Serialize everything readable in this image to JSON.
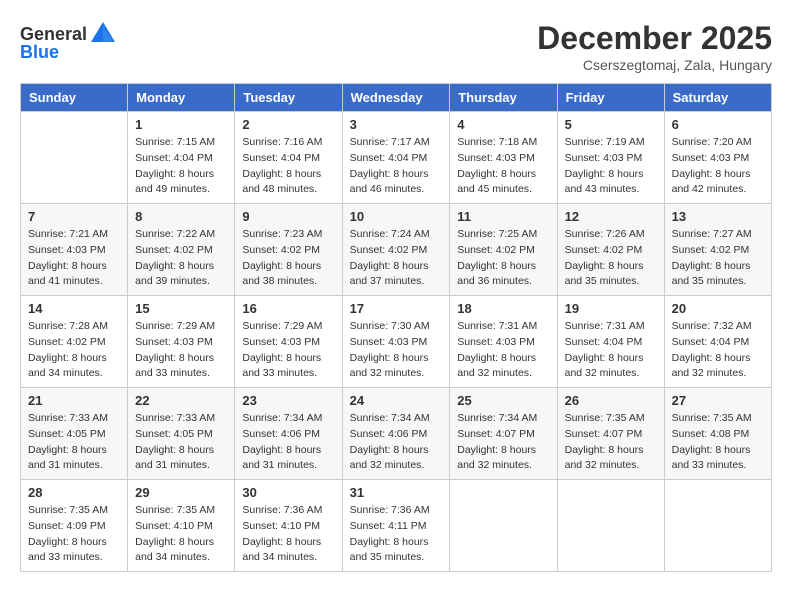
{
  "header": {
    "logo_general": "General",
    "logo_blue": "Blue",
    "month_title": "December 2025",
    "location": "Cserszegtomaj, Zala, Hungary"
  },
  "weekdays": [
    "Sunday",
    "Monday",
    "Tuesday",
    "Wednesday",
    "Thursday",
    "Friday",
    "Saturday"
  ],
  "weeks": [
    [
      {
        "day": "",
        "info": ""
      },
      {
        "day": "1",
        "info": "Sunrise: 7:15 AM\nSunset: 4:04 PM\nDaylight: 8 hours\nand 49 minutes."
      },
      {
        "day": "2",
        "info": "Sunrise: 7:16 AM\nSunset: 4:04 PM\nDaylight: 8 hours\nand 48 minutes."
      },
      {
        "day": "3",
        "info": "Sunrise: 7:17 AM\nSunset: 4:04 PM\nDaylight: 8 hours\nand 46 minutes."
      },
      {
        "day": "4",
        "info": "Sunrise: 7:18 AM\nSunset: 4:03 PM\nDaylight: 8 hours\nand 45 minutes."
      },
      {
        "day": "5",
        "info": "Sunrise: 7:19 AM\nSunset: 4:03 PM\nDaylight: 8 hours\nand 43 minutes."
      },
      {
        "day": "6",
        "info": "Sunrise: 7:20 AM\nSunset: 4:03 PM\nDaylight: 8 hours\nand 42 minutes."
      }
    ],
    [
      {
        "day": "7",
        "info": "Sunrise: 7:21 AM\nSunset: 4:03 PM\nDaylight: 8 hours\nand 41 minutes."
      },
      {
        "day": "8",
        "info": "Sunrise: 7:22 AM\nSunset: 4:02 PM\nDaylight: 8 hours\nand 39 minutes."
      },
      {
        "day": "9",
        "info": "Sunrise: 7:23 AM\nSunset: 4:02 PM\nDaylight: 8 hours\nand 38 minutes."
      },
      {
        "day": "10",
        "info": "Sunrise: 7:24 AM\nSunset: 4:02 PM\nDaylight: 8 hours\nand 37 minutes."
      },
      {
        "day": "11",
        "info": "Sunrise: 7:25 AM\nSunset: 4:02 PM\nDaylight: 8 hours\nand 36 minutes."
      },
      {
        "day": "12",
        "info": "Sunrise: 7:26 AM\nSunset: 4:02 PM\nDaylight: 8 hours\nand 35 minutes."
      },
      {
        "day": "13",
        "info": "Sunrise: 7:27 AM\nSunset: 4:02 PM\nDaylight: 8 hours\nand 35 minutes."
      }
    ],
    [
      {
        "day": "14",
        "info": "Sunrise: 7:28 AM\nSunset: 4:02 PM\nDaylight: 8 hours\nand 34 minutes."
      },
      {
        "day": "15",
        "info": "Sunrise: 7:29 AM\nSunset: 4:03 PM\nDaylight: 8 hours\nand 33 minutes."
      },
      {
        "day": "16",
        "info": "Sunrise: 7:29 AM\nSunset: 4:03 PM\nDaylight: 8 hours\nand 33 minutes."
      },
      {
        "day": "17",
        "info": "Sunrise: 7:30 AM\nSunset: 4:03 PM\nDaylight: 8 hours\nand 32 minutes."
      },
      {
        "day": "18",
        "info": "Sunrise: 7:31 AM\nSunset: 4:03 PM\nDaylight: 8 hours\nand 32 minutes."
      },
      {
        "day": "19",
        "info": "Sunrise: 7:31 AM\nSunset: 4:04 PM\nDaylight: 8 hours\nand 32 minutes."
      },
      {
        "day": "20",
        "info": "Sunrise: 7:32 AM\nSunset: 4:04 PM\nDaylight: 8 hours\nand 32 minutes."
      }
    ],
    [
      {
        "day": "21",
        "info": "Sunrise: 7:33 AM\nSunset: 4:05 PM\nDaylight: 8 hours\nand 31 minutes."
      },
      {
        "day": "22",
        "info": "Sunrise: 7:33 AM\nSunset: 4:05 PM\nDaylight: 8 hours\nand 31 minutes."
      },
      {
        "day": "23",
        "info": "Sunrise: 7:34 AM\nSunset: 4:06 PM\nDaylight: 8 hours\nand 31 minutes."
      },
      {
        "day": "24",
        "info": "Sunrise: 7:34 AM\nSunset: 4:06 PM\nDaylight: 8 hours\nand 32 minutes."
      },
      {
        "day": "25",
        "info": "Sunrise: 7:34 AM\nSunset: 4:07 PM\nDaylight: 8 hours\nand 32 minutes."
      },
      {
        "day": "26",
        "info": "Sunrise: 7:35 AM\nSunset: 4:07 PM\nDaylight: 8 hours\nand 32 minutes."
      },
      {
        "day": "27",
        "info": "Sunrise: 7:35 AM\nSunset: 4:08 PM\nDaylight: 8 hours\nand 33 minutes."
      }
    ],
    [
      {
        "day": "28",
        "info": "Sunrise: 7:35 AM\nSunset: 4:09 PM\nDaylight: 8 hours\nand 33 minutes."
      },
      {
        "day": "29",
        "info": "Sunrise: 7:35 AM\nSunset: 4:10 PM\nDaylight: 8 hours\nand 34 minutes."
      },
      {
        "day": "30",
        "info": "Sunrise: 7:36 AM\nSunset: 4:10 PM\nDaylight: 8 hours\nand 34 minutes."
      },
      {
        "day": "31",
        "info": "Sunrise: 7:36 AM\nSunset: 4:11 PM\nDaylight: 8 hours\nand 35 minutes."
      },
      {
        "day": "",
        "info": ""
      },
      {
        "day": "",
        "info": ""
      },
      {
        "day": "",
        "info": ""
      }
    ]
  ]
}
